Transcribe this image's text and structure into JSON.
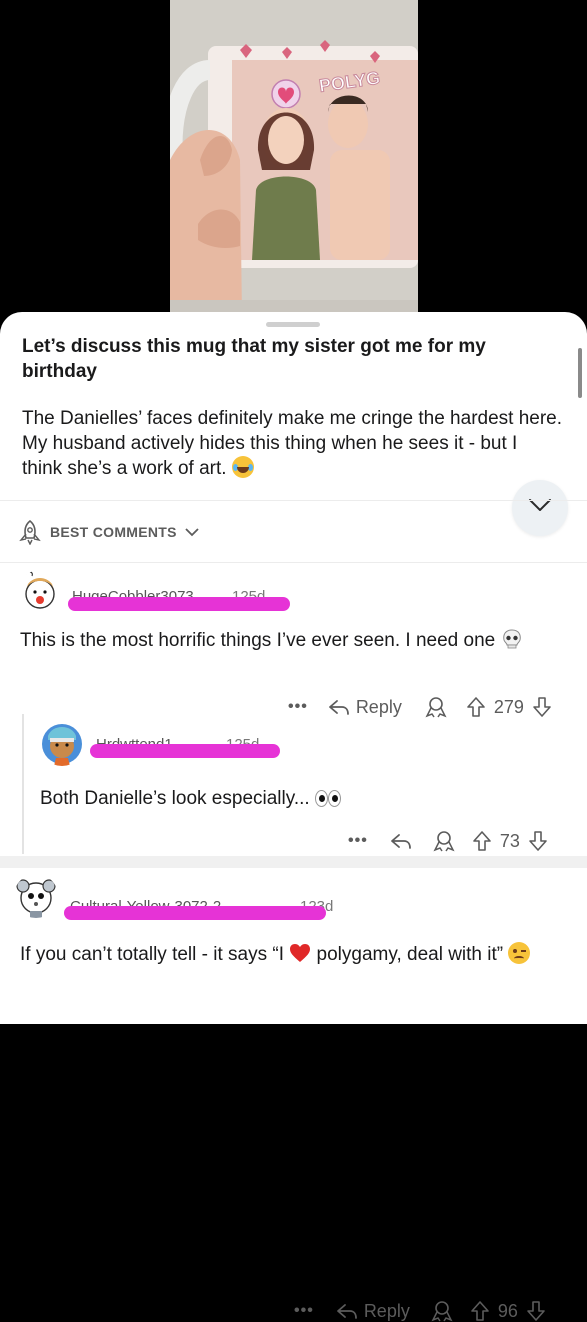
{
  "post": {
    "title": "Let’s discuss this mug that my sister got me for my birthday",
    "body": "The Danielles’ faces definitely make me cringe the hardest here. My husband actively hides this thing when he sees it - but I think she’s a work of art."
  },
  "mug": {
    "text": "POLYG"
  },
  "sort": {
    "label": "BEST COMMENTS"
  },
  "comments": [
    {
      "username": "HugeCobbler3073",
      "age": "125d",
      "text": "This is the most horrific things I’ve ever seen. I need one",
      "reply_label": "Reply",
      "score": "279"
    },
    {
      "username": "Hrdwttend1",
      "age": "125d",
      "text": "Both Danielle’s look especially...",
      "score": "73"
    },
    {
      "username": "Cultural-Yellow-3072-2",
      "age": "123d",
      "text_before": "If you can’t totally tell - it says “I",
      "text_after": "polygamy, deal with it”",
      "reply_label": "Reply",
      "score": "96"
    }
  ],
  "icons": [
    "more-icon",
    "reply-icon",
    "award-icon",
    "upvote-icon",
    "downvote-icon",
    "chevron-down-icon",
    "rocket-icon"
  ],
  "colors": {
    "redaction": "#e633d6",
    "heart": "#e02828"
  }
}
